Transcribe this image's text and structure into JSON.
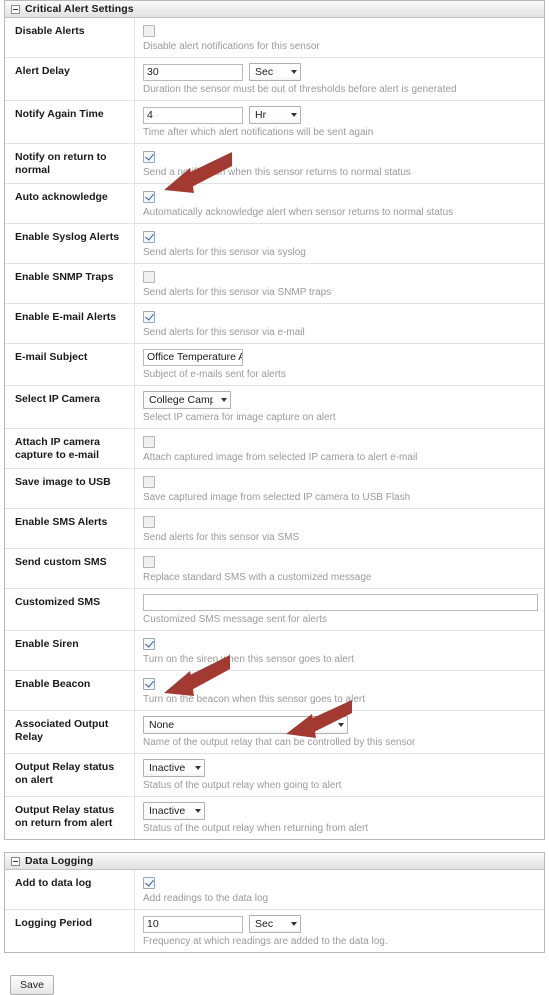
{
  "sections": [
    {
      "id": "critical-alert-settings",
      "title": "Critical Alert Settings",
      "collapse_icon": "minus-box-icon",
      "rows": [
        {
          "label": "Disable Alerts",
          "type": "checkbox",
          "checked": false,
          "hint": "Disable alert notifications for this sensor"
        },
        {
          "label": "Alert Delay",
          "type": "text-unit",
          "value": "30",
          "unit": "Sec",
          "hint": "Duration the sensor must be out of thresholds before alert is generated"
        },
        {
          "label": "Notify Again Time",
          "type": "text-unit",
          "value": "4",
          "unit": "Hr",
          "hint": "Time after which alert notifications will be sent again"
        },
        {
          "label": "Notify on return to normal",
          "type": "checkbox",
          "checked": true,
          "hint": "Send a notification when this sensor returns to normal status"
        },
        {
          "label": "Auto acknowledge",
          "type": "checkbox",
          "checked": true,
          "hint": "Automatically acknowledge alert when sensor returns to normal status"
        },
        {
          "label": "Enable Syslog Alerts",
          "type": "checkbox",
          "checked": true,
          "hint": "Send alerts for this sensor via syslog"
        },
        {
          "label": "Enable SNMP Traps",
          "type": "checkbox",
          "checked": false,
          "hint": "Send alerts for this sensor via SNMP traps"
        },
        {
          "label": "Enable E-mail Alerts",
          "type": "checkbox",
          "checked": true,
          "hint": "Send alerts for this sensor via e-mail"
        },
        {
          "label": "E-mail Subject",
          "type": "text",
          "value": "Office Temperature Al",
          "hint": "Subject of e-mails sent for alerts"
        },
        {
          "label": "Select IP Camera",
          "type": "select-cam",
          "value": "College Campus",
          "hint": "Select IP camera for image capture on alert"
        },
        {
          "label": "Attach IP camera capture to e-mail",
          "type": "checkbox",
          "checked": false,
          "hint": "Attach captured image from selected IP camera to alert e-mail"
        },
        {
          "label": "Save image to USB",
          "type": "checkbox",
          "checked": false,
          "hint": "Save captured image from selected IP camera to USB Flash"
        },
        {
          "label": "Enable SMS Alerts",
          "type": "checkbox",
          "checked": false,
          "hint": "Send alerts for this sensor via SMS"
        },
        {
          "label": "Send custom SMS",
          "type": "checkbox",
          "checked": false,
          "hint": "Replace standard SMS with a customized message"
        },
        {
          "label": "Customized SMS",
          "type": "text-wide",
          "value": "",
          "hint": "Customized SMS message sent for alerts"
        },
        {
          "label": "Enable Siren",
          "type": "checkbox",
          "checked": true,
          "hint": "Turn on the siren when this sensor goes to alert"
        },
        {
          "label": "Enable Beacon",
          "type": "checkbox",
          "checked": true,
          "hint": "Turn on the beacon when this sensor goes to alert"
        },
        {
          "label": "Associated Output Relay",
          "type": "select-relay",
          "value": "None",
          "hint": "Name of the output relay that can be controlled by this sensor"
        },
        {
          "label": "Output Relay status on alert",
          "type": "select-status",
          "value": "Inactive",
          "hint": "Status of the output relay when going to alert"
        },
        {
          "label": "Output Relay status on return from alert",
          "type": "select-status",
          "value": "Inactive",
          "hint": "Status of the output relay when returning from alert"
        }
      ]
    },
    {
      "id": "data-logging",
      "title": "Data Logging",
      "collapse_icon": "minus-box-icon",
      "rows": [
        {
          "label": "Add to data log",
          "type": "checkbox",
          "checked": true,
          "hint": "Add readings to the data log"
        },
        {
          "label": "Logging Period",
          "type": "text-unit",
          "value": "10",
          "unit": "Sec",
          "hint": "Frequency at which readings are added to the data log."
        }
      ]
    }
  ],
  "footer": {
    "save_label": "Save"
  },
  "annotations": {
    "arrow_color": "#a33a32",
    "arrows": [
      {
        "name": "arrow-to-syslog-checkbox",
        "target": "Enable Syslog Alerts"
      },
      {
        "name": "arrow-to-add-to-data-log-checkbox",
        "target": "Add to data log"
      },
      {
        "name": "arrow-to-logging-period-unit",
        "target": "Logging Period unit"
      }
    ]
  }
}
